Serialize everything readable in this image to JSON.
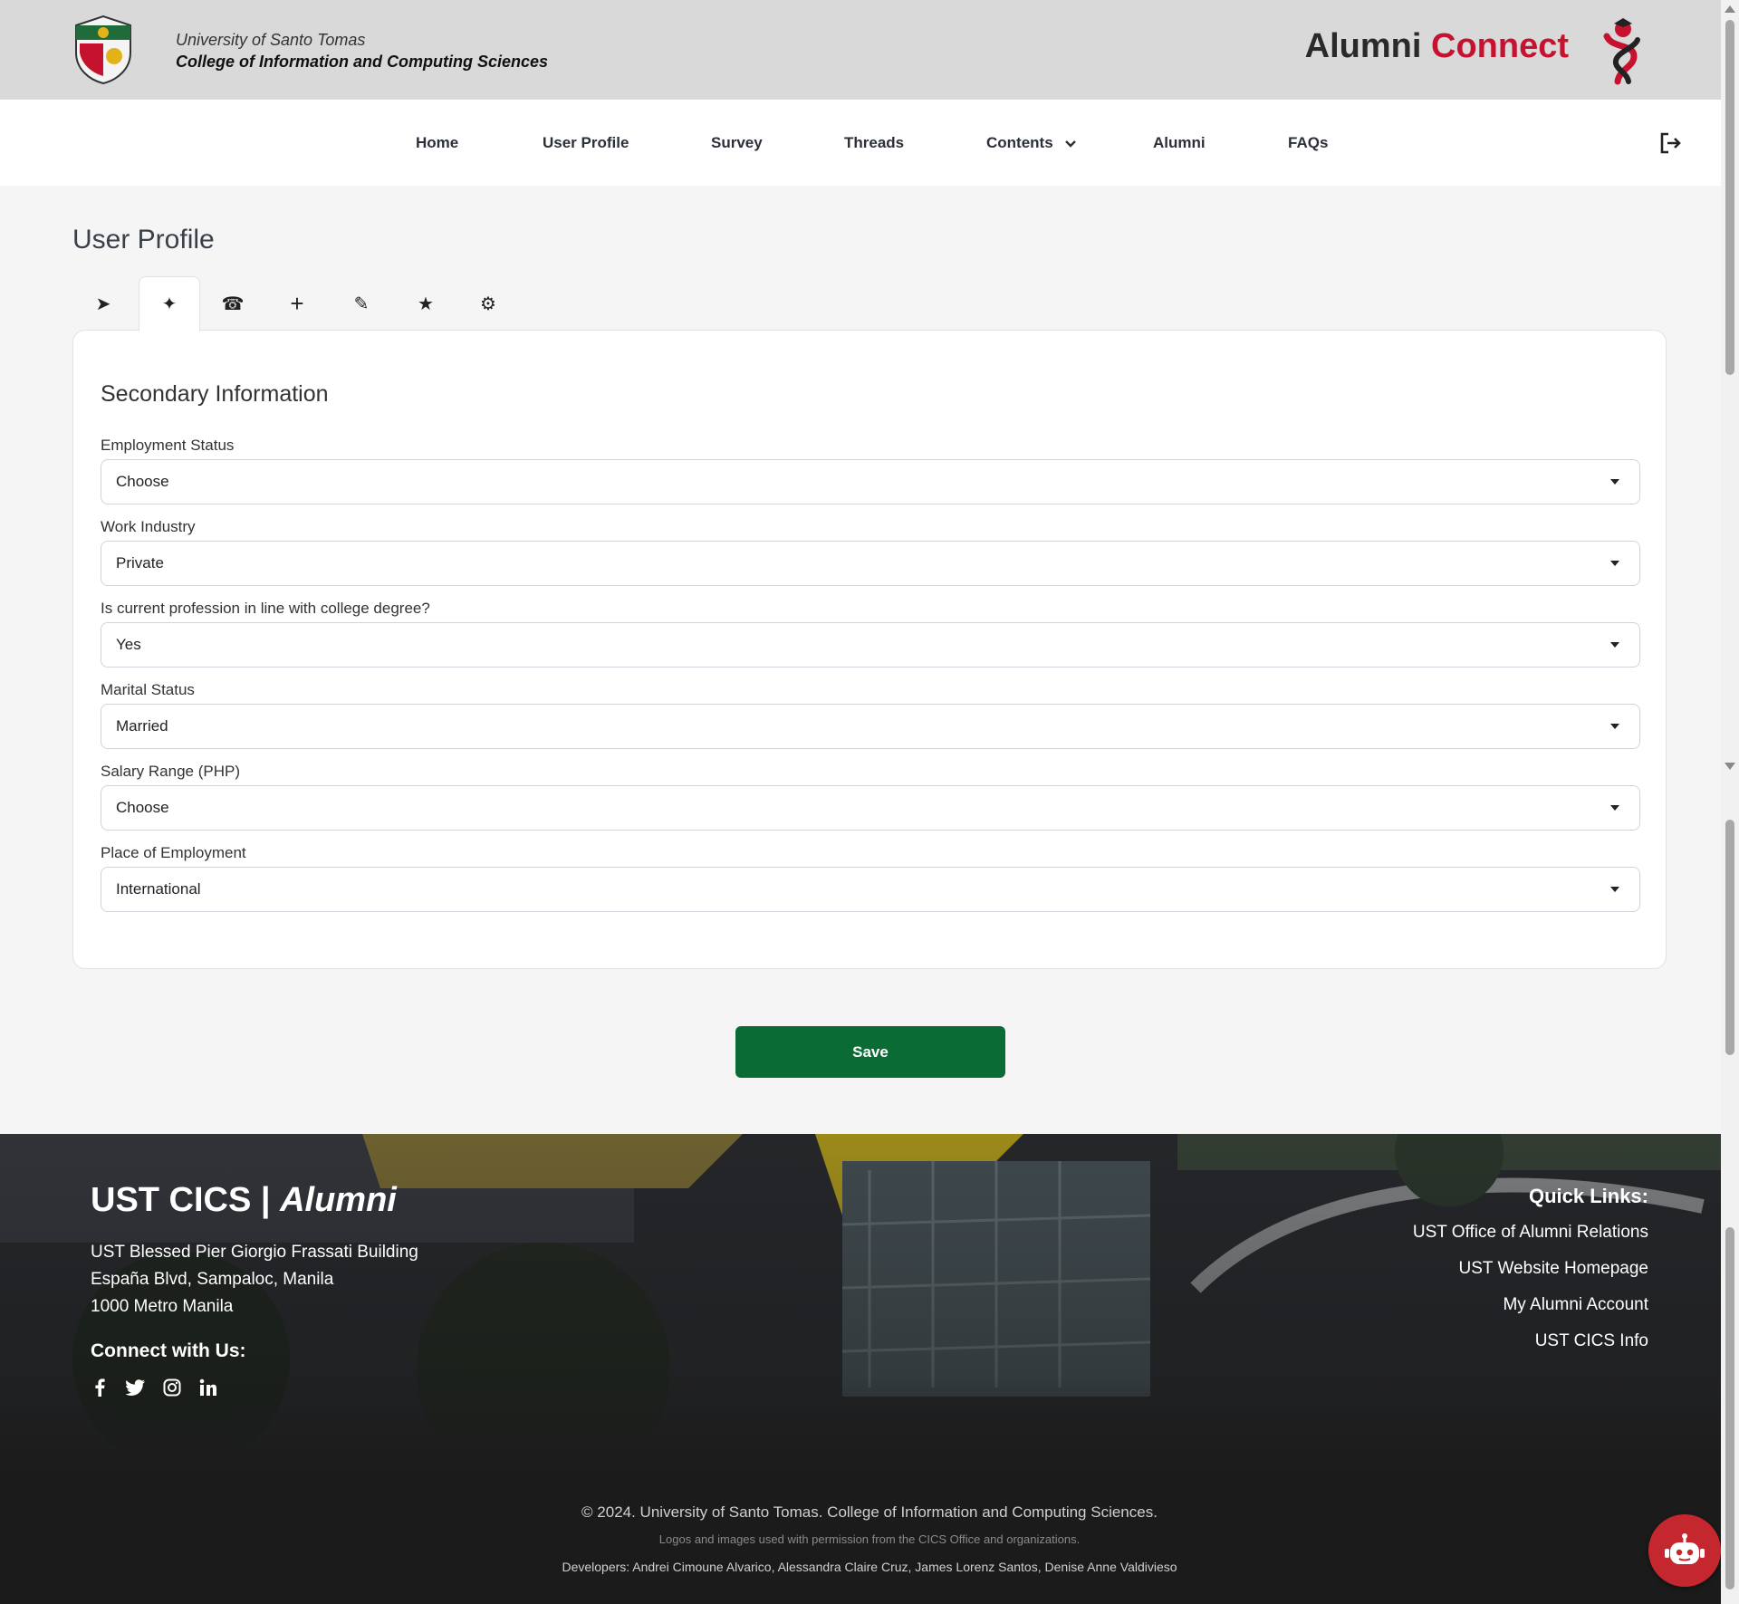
{
  "header": {
    "university": "University of Santo Tomas",
    "college": "College of Information and Computing Sciences",
    "brand_part1": "Alumni",
    "brand_part2": "Connect",
    "brand_color": "#c4122f"
  },
  "nav": {
    "items": [
      {
        "label": "Home"
      },
      {
        "label": "User Profile"
      },
      {
        "label": "Survey"
      },
      {
        "label": "Threads"
      },
      {
        "label": "Contents"
      },
      {
        "label": "Alumni"
      },
      {
        "label": "FAQs"
      }
    ],
    "logout_icon": "logout-icon"
  },
  "page": {
    "title": "User Profile"
  },
  "tabs": [
    {
      "icon": "send-icon",
      "glyph": "➤",
      "active": false
    },
    {
      "icon": "sparkle-icon",
      "glyph": "✦",
      "active": true
    },
    {
      "icon": "phone-icon",
      "glyph": "☎",
      "active": false
    },
    {
      "icon": "plus-icon",
      "glyph": "+",
      "active": false
    },
    {
      "icon": "pencil-icon",
      "glyph": "✎",
      "active": false
    },
    {
      "icon": "star-icon",
      "glyph": "★",
      "active": false
    },
    {
      "icon": "gear-icon",
      "glyph": "⚙",
      "active": false
    }
  ],
  "form": {
    "section_title": "Secondary Information",
    "fields": [
      {
        "label": "Employment Status",
        "value": "Choose"
      },
      {
        "label": "Work Industry",
        "value": "Private"
      },
      {
        "label": "Is current profession in line with college degree?",
        "value": "Yes"
      },
      {
        "label": "Marital Status",
        "value": "Married"
      },
      {
        "label": "Salary Range (PHP)",
        "value": "Choose"
      },
      {
        "label": "Place of Employment",
        "value": "International"
      }
    ],
    "save_label": "Save",
    "save_color": "#0b6b35"
  },
  "footer": {
    "brand_a": "UST CICS | ",
    "brand_b": "Alumni",
    "address_1": "UST Blessed Pier Giorgio Frassati Building",
    "address_2": "España Blvd, Sampaloc, Manila",
    "address_3": "1000 Metro Manila",
    "connect_title": "Connect with Us:",
    "socials": [
      "facebook-icon",
      "twitter-icon",
      "instagram-icon",
      "linkedin-icon"
    ],
    "quick_links_title": "Quick Links:",
    "quick_links": [
      "UST Office of Alumni Relations",
      "UST Website Homepage",
      "My Alumni Account",
      "UST CICS Info"
    ],
    "copyright": "© 2024. University of Santo Tomas. College of Information and Computing Sciences.",
    "logos_note": "Logos and images used with permission from the CICS Office and organizations.",
    "developers": "Developers: Andrei Cimoune Alvarico, Alessandra Claire Cruz, James Lorenz Santos, Denise Anne Valdivieso"
  }
}
